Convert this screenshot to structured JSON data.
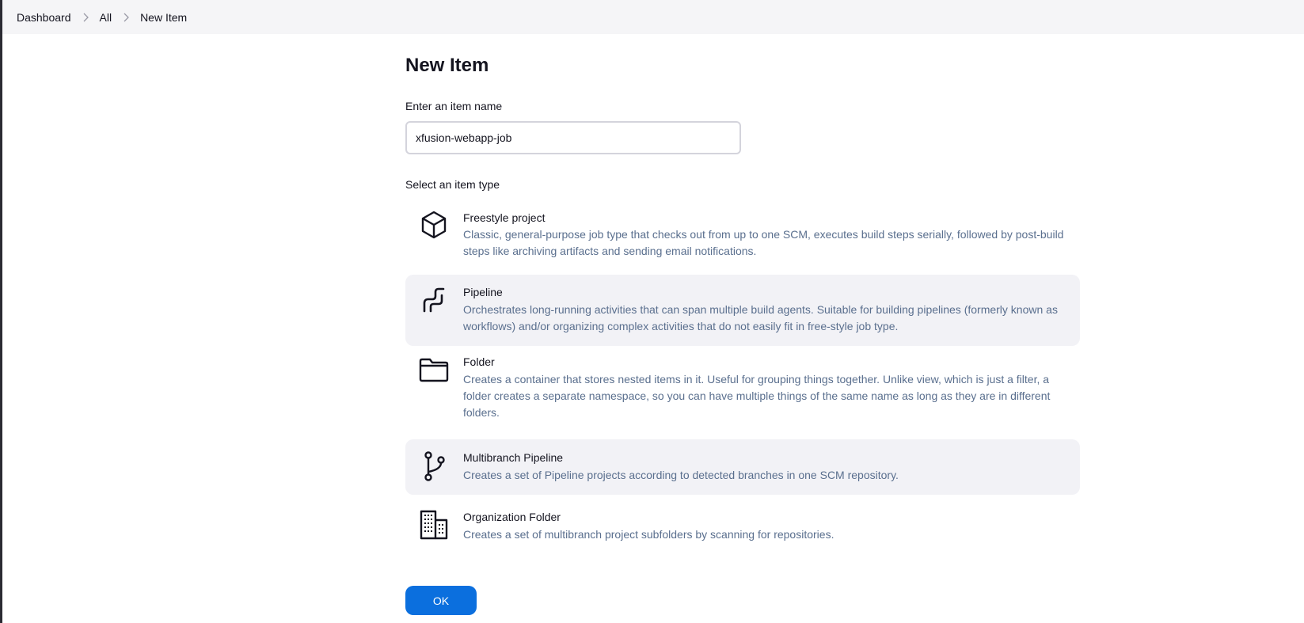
{
  "breadcrumb": {
    "items": [
      "Dashboard",
      "All",
      "New Item"
    ]
  },
  "page": {
    "title": "New Item",
    "name_label": "Enter an item name",
    "name_value": "xfusion-webapp-job",
    "type_label": "Select an item type",
    "ok_label": "OK"
  },
  "item_types": [
    {
      "title": "Freestyle project",
      "description": "Classic, general-purpose job type that checks out from up to one SCM, executes build steps serially, followed by post-build steps like archiving artifacts and sending email notifications.",
      "icon": "box-icon"
    },
    {
      "title": "Pipeline",
      "description": "Orchestrates long-running activities that can span multiple build agents. Suitable for building pipelines (formerly known as workflows) and/or organizing complex activities that do not easily fit in free-style job type.",
      "icon": "pipeline-icon"
    },
    {
      "title": "Folder",
      "description": "Creates a container that stores nested items in it. Useful for grouping things together. Unlike view, which is just a filter, a folder creates a separate namespace, so you can have multiple things of the same name as long as they are in different folders.",
      "icon": "folder-icon"
    },
    {
      "title": "Multibranch Pipeline",
      "description": "Creates a set of Pipeline projects according to detected branches in one SCM repository.",
      "icon": "git-branch-icon"
    },
    {
      "title": "Organization Folder",
      "description": "Creates a set of multibranch project subfolders by scanning for repositories.",
      "icon": "building-icon"
    }
  ],
  "colors": {
    "accent": "#0b6fde",
    "description_text": "#5a6f8e",
    "highlight_bg": "#f2f2f6",
    "breadcrumb_bg": "#f5f5f7"
  }
}
